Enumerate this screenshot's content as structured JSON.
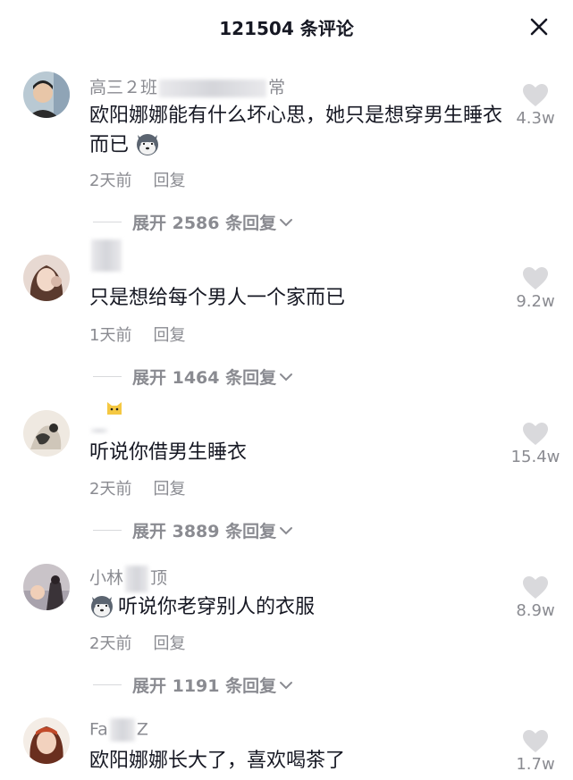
{
  "header": {
    "title": "121504 条评论",
    "close_icon": "close-icon"
  },
  "comments": [
    {
      "username_prefix": "高三２班",
      "username_suffix": "常",
      "text": "欧阳娜娜能有什么坏心思，她只是想穿男生睡衣而已",
      "emoji": "husky-dog-emoji",
      "time": "2天前",
      "reply_label": "回复",
      "likes": "4.3w",
      "expand_label": "展开 2586 条回复"
    },
    {
      "username_prefix": "",
      "username_suffix": "",
      "text": "只是想给每个男人一个家而已",
      "time": "1天前",
      "reply_label": "回复",
      "likes": "9.2w",
      "expand_label": "展开 1464 条回复"
    },
    {
      "username_prefix": "",
      "username_suffix": "",
      "text": "听说你借男生睡衣",
      "time": "2天前",
      "reply_label": "回复",
      "likes": "15.4w",
      "expand_label": "展开 3889 条回复"
    },
    {
      "username_prefix": "小林",
      "username_suffix": "顶",
      "text": "听说你老穿别人的衣服",
      "emoji": "husky-dog-emoji",
      "time": "2天前",
      "reply_label": "回复",
      "likes": "8.9w",
      "expand_label": "展开 1191 条回复"
    },
    {
      "username_prefix": "Fa",
      "username_suffix": "Z",
      "text": "欧阳娜娜长大了，喜欢喝茶了",
      "likes": "1.7w"
    }
  ],
  "colors": {
    "text": "#161823",
    "secondary": "#8a8b91",
    "heart": "#d9d9dc"
  }
}
